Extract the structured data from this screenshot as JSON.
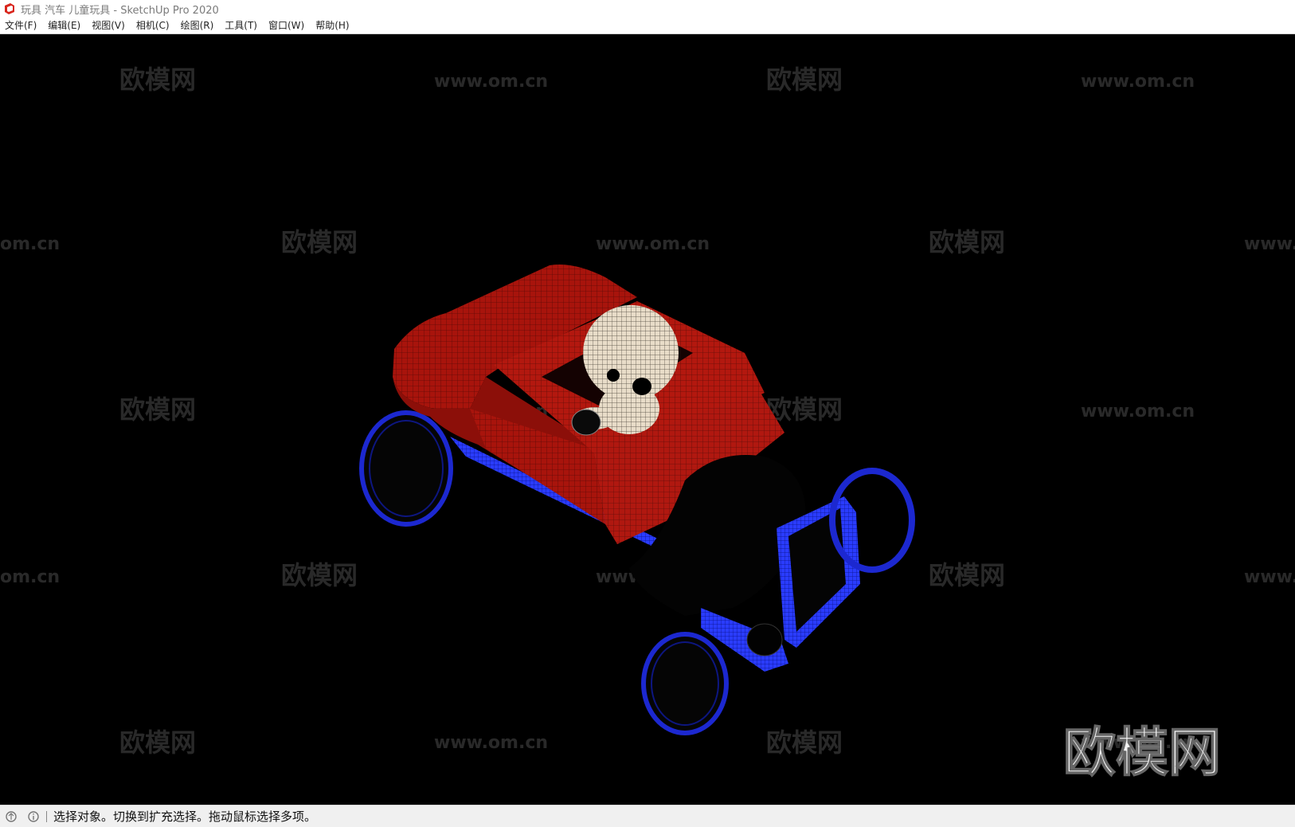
{
  "window": {
    "title": "玩具 汽车 儿童玩具 - SketchUp Pro 2020"
  },
  "menu": [
    {
      "label": "文件(F)"
    },
    {
      "label": "编辑(E)"
    },
    {
      "label": "视图(V)"
    },
    {
      "label": "相机(C)"
    },
    {
      "label": "绘图(R)"
    },
    {
      "label": "工具(T)"
    },
    {
      "label": "窗口(W)"
    },
    {
      "label": "帮助(H)"
    }
  ],
  "viewport": {
    "background": "#000000",
    "model": "toy car with doll driver",
    "colors": {
      "body": "#b01810",
      "trim": "#2030ff",
      "doll": "#e8dcc8"
    },
    "watermarks": {
      "logo_text": "欧模网",
      "url_text": "www.om.cn",
      "partial_url_left": "om.cn",
      "partial_url_right": "www."
    },
    "brand_logo": "欧模网"
  },
  "status": {
    "message": "选择对象。切换到扩充选择。拖动鼠标选择多项。",
    "icons": [
      "geo-location-icon",
      "info-icon"
    ]
  }
}
